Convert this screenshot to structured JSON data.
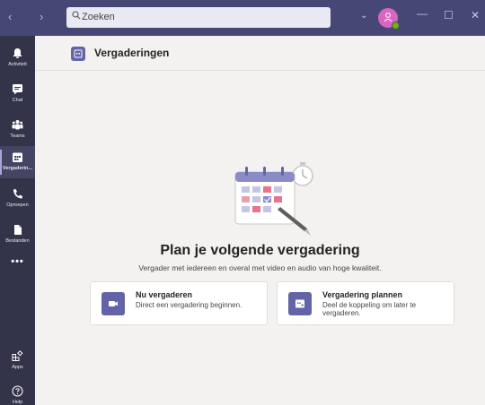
{
  "titlebar": {
    "search_placeholder": "Zoeken",
    "back_icon": "chevron-left-icon",
    "forward_icon": "chevron-right-icon",
    "minimize": "—",
    "maximize": "☐",
    "close": "✕",
    "chevron": "⌄"
  },
  "rail": {
    "items": [
      {
        "label": "Activiteit",
        "icon": "bell-icon"
      },
      {
        "label": "Chat",
        "icon": "chat-icon"
      },
      {
        "label": "Teams",
        "icon": "teams-icon"
      },
      {
        "label": "Vergaderin...",
        "icon": "calendar-icon",
        "active": true
      },
      {
        "label": "Oproepen",
        "icon": "phone-icon"
      },
      {
        "label": "Bestanden",
        "icon": "file-icon"
      }
    ],
    "more": "•••",
    "bottom_items": [
      {
        "label": "Apps",
        "icon": "apps-icon"
      },
      {
        "label": "Help",
        "icon": "help-icon"
      }
    ]
  },
  "header": {
    "title": "Vergaderingen"
  },
  "main": {
    "headline": "Plan je volgende vergadering",
    "subline": "Vergader met iedereen en overal met video en audio van hoge kwaliteit."
  },
  "cards": [
    {
      "title": "Nu vergaderen",
      "desc": "Direct een vergadering beginnen.",
      "icon": "video-camera-icon"
    },
    {
      "title": "Vergadering plannen",
      "desc": "Deel de koppeling om later te vergaderen.",
      "icon": "calendar-add-icon"
    }
  ],
  "colors": {
    "brand": "#6264a7",
    "titlebar": "#464775",
    "rail": "#33344a"
  }
}
